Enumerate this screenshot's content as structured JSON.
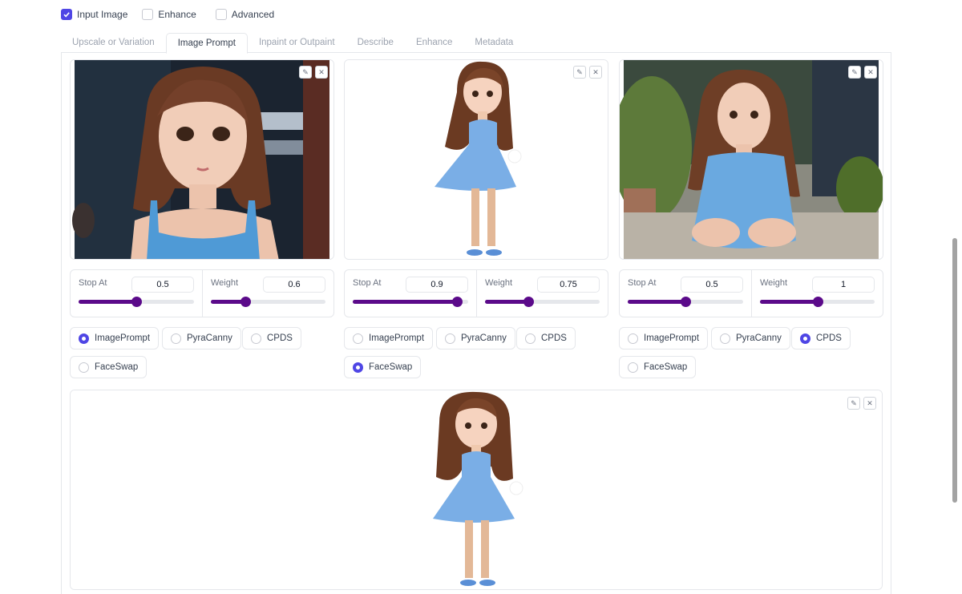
{
  "checkboxes": [
    {
      "label": "Input Image",
      "checked": true
    },
    {
      "label": "Enhance",
      "checked": false
    },
    {
      "label": "Advanced",
      "checked": false
    }
  ],
  "tabs": [
    "Upscale or Variation",
    "Image Prompt",
    "Inpaint or Outpaint",
    "Describe",
    "Enhance",
    "Metadata"
  ],
  "active_tab": "Image Prompt",
  "accent_color": "#4f46e5",
  "slider_color": "#5b0a8a",
  "image_slots": [
    {
      "image": "realistic-girl-blue-tank-top",
      "stop_at": {
        "label": "Stop At",
        "value": "0.5",
        "fraction": 0.5
      },
      "weight": {
        "label": "Weight",
        "value": "0.6",
        "fraction": 0.3
      },
      "types": [
        "ImagePrompt",
        "PyraCanny",
        "CPDS",
        "FaceSwap"
      ],
      "selected": "ImagePrompt"
    },
    {
      "image": "cartoon-girl-blue-dress",
      "stop_at": {
        "label": "Stop At",
        "value": "0.9",
        "fraction": 0.9
      },
      "weight": {
        "label": "Weight",
        "value": "0.75",
        "fraction": 0.375
      },
      "types": [
        "ImagePrompt",
        "PyraCanny",
        "CPDS",
        "FaceSwap"
      ],
      "selected": "FaceSwap"
    },
    {
      "image": "realistic-girl-sitting-blue-dress",
      "stop_at": {
        "label": "Stop At",
        "value": "0.5",
        "fraction": 0.5
      },
      "weight": {
        "label": "Weight",
        "value": "1",
        "fraction": 0.5
      },
      "types": [
        "ImagePrompt",
        "PyraCanny",
        "CPDS",
        "FaceSwap"
      ],
      "selected": "CPDS"
    }
  ],
  "bottom_image": "cartoon-girl-blue-dress",
  "icons": {
    "edit": "pencil-icon",
    "close": "close-icon"
  }
}
